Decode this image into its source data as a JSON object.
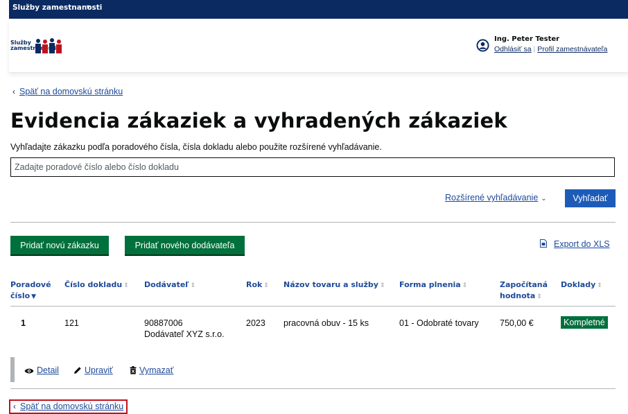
{
  "topbar": {
    "label": "Služby zamestnanosti"
  },
  "header": {
    "logo_line1": "Služby",
    "logo_line2": "zamestnanosti",
    "user_name": "Ing. Peter Tester",
    "logout_label": "Odhlásiť sa",
    "profile_label": "Profil zamestnávateľa"
  },
  "back_link": "Späť na domovskú stránku",
  "page_title": "Evidencia zákaziek a vyhradených zákaziek",
  "search": {
    "hint": "Vyhľadajte zákazku podľa poradového čísla, čísla dokladu alebo použite rozšírené vyhľadávanie.",
    "placeholder": "Zadajte poradové číslo alebo číslo dokladu",
    "advanced_label": "Rozšírené vyhľadávanie",
    "submit_label": "Vyhľadať"
  },
  "actions": {
    "add_order": "Pridať novú zákazku",
    "add_supplier": "Pridať nového dodávateľa",
    "export": "Export do XLS"
  },
  "table": {
    "columns": [
      {
        "line1": "Poradové",
        "line2": "číslo"
      },
      {
        "line1": "Číslo dokladu"
      },
      {
        "line1": "Dodávateľ"
      },
      {
        "line1": "Rok"
      },
      {
        "line1": "Názov tovaru a služby"
      },
      {
        "line1": "Forma plnenia"
      },
      {
        "line1": "Započítaná",
        "line2": "hodnota"
      },
      {
        "line1": "Doklady"
      }
    ],
    "rows": [
      {
        "poradove_cislo": "1",
        "cislo_dokladu": "121",
        "dodavatel_ico": "90887006",
        "dodavatel_name": "Dodávateľ XYZ s.r.o.",
        "rok": "2023",
        "nazov": "pracovná obuv - 15 ks",
        "forma_plnenia": "01 - Odobraté tovary",
        "hodnota": "750,00 €",
        "doklady": "Kompletné"
      }
    ],
    "row_actions": {
      "detail": "Detail",
      "edit": "Upraviť",
      "delete": "Vymazať"
    }
  },
  "colors": {
    "navy": "#0b2a62",
    "link": "#1d4a99",
    "green": "#00703c",
    "primary": "#1d5bb8",
    "highlight": "#c0121e"
  }
}
